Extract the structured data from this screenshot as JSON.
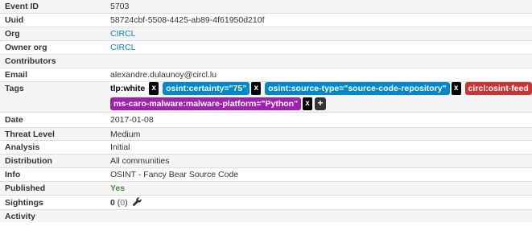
{
  "rows": {
    "event_id": {
      "label": "Event ID",
      "value": "5703"
    },
    "uuid": {
      "label": "Uuid",
      "value": "58724cbf-5508-4425-ab89-4f61950d210f"
    },
    "org": {
      "label": "Org",
      "value": "CIRCL"
    },
    "owner_org": {
      "label": "Owner org",
      "value": "CIRCL"
    },
    "contributors": {
      "label": "Contributors",
      "value": ""
    },
    "email": {
      "label": "Email",
      "value": "alexandre.dulaunoy@circl.lu"
    },
    "tags": {
      "label": "Tags",
      "items": [
        {
          "text": "tlp:white",
          "bg": "#ffffff",
          "fg": "#000000"
        },
        {
          "text": "osint:certainty=\"75\"",
          "bg": "#0088cc",
          "fg": "#ffffff"
        },
        {
          "text": "osint:source-type=\"source-code-repository\"",
          "bg": "#0088cc",
          "fg": "#ffffff"
        },
        {
          "text": "circl:osint-feed",
          "bg": "#cc3333",
          "fg": "#ffffff"
        },
        {
          "text": "ms-caro-malware:malware-platform=\"Python\"",
          "bg": "#a020b0",
          "fg": "#ffffff"
        }
      ],
      "remove_label": "x",
      "add_label": "+"
    },
    "date": {
      "label": "Date",
      "value": "2017-01-08"
    },
    "threat_level": {
      "label": "Threat Level",
      "value": "Medium"
    },
    "analysis": {
      "label": "Analysis",
      "value": "Initial"
    },
    "distribution": {
      "label": "Distribution",
      "value": "All communities"
    },
    "info": {
      "label": "Info",
      "value": "OSINT - Fancy Bear Source Code"
    },
    "published": {
      "label": "Published",
      "value": "Yes"
    },
    "sightings": {
      "label": "Sightings",
      "count": "0",
      "open": "(",
      "inner": "0",
      "close": ")",
      "icon": "wrench-icon"
    },
    "activity": {
      "label": "Activity",
      "value": ""
    }
  },
  "colors": {
    "link": "#0088cc",
    "published": "#468847",
    "stripe": "#f5f5f5"
  }
}
